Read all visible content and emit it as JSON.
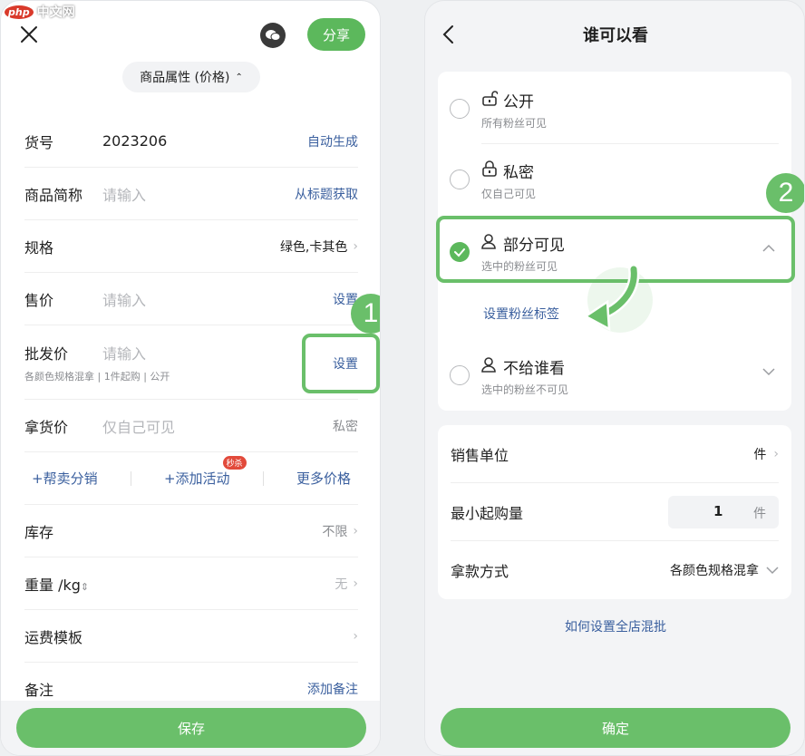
{
  "watermark": {
    "logo": "php",
    "text": "中文网"
  },
  "left": {
    "share_label": "分享",
    "attr_pill": "商品属性 (价格)",
    "rows": {
      "sku": {
        "label": "货号",
        "value": "2023206",
        "action": "自动生成"
      },
      "short_name": {
        "label": "商品简称",
        "placeholder": "请输入",
        "action": "从标题获取"
      },
      "spec": {
        "label": "规格",
        "value": "绿色,卡其色"
      },
      "price": {
        "label": "售价",
        "placeholder": "请输入",
        "action": "设置"
      },
      "wholesale": {
        "label": "批发价",
        "placeholder": "请输入",
        "action": "设置",
        "sub": "各颜色规格混拿 | 1件起购 | 公开"
      },
      "pickup": {
        "label": "拿货价",
        "placeholder": "仅自己可见",
        "value": "私密"
      },
      "stock": {
        "label": "库存",
        "value": "不限"
      },
      "weight": {
        "label": "重量 /kg",
        "value": "无"
      },
      "shipping": {
        "label": "运费模板"
      },
      "note": {
        "label": "备注",
        "action": "添加备注"
      }
    },
    "actions": {
      "help_sell": "+帮卖分销",
      "add_activity": "+添加活动",
      "seckill": "秒杀",
      "more_price": "更多价格"
    },
    "save": "保存",
    "badge": "1"
  },
  "right": {
    "title": "谁可以看",
    "options": [
      {
        "title": "公开",
        "sub": "所有粉丝可见"
      },
      {
        "title": "私密",
        "sub": "仅自己可见"
      },
      {
        "title": "部分可见",
        "sub": "选中的粉丝可见"
      },
      {
        "title": "不给谁看",
        "sub": "选中的粉丝不可见"
      }
    ],
    "set_tag": "设置粉丝标签",
    "unit": {
      "label": "销售单位",
      "value": "件"
    },
    "min_qty": {
      "label": "最小起购量",
      "value": "1",
      "unit": "件"
    },
    "mix": {
      "label": "拿款方式",
      "value": "各颜色规格混拿"
    },
    "help_link": "如何设置全店混批",
    "confirm": "确定",
    "badge": "2"
  },
  "colors": {
    "accent": "#6abf6a",
    "link": "#3a5f9e",
    "tag": "#e24a3b"
  }
}
